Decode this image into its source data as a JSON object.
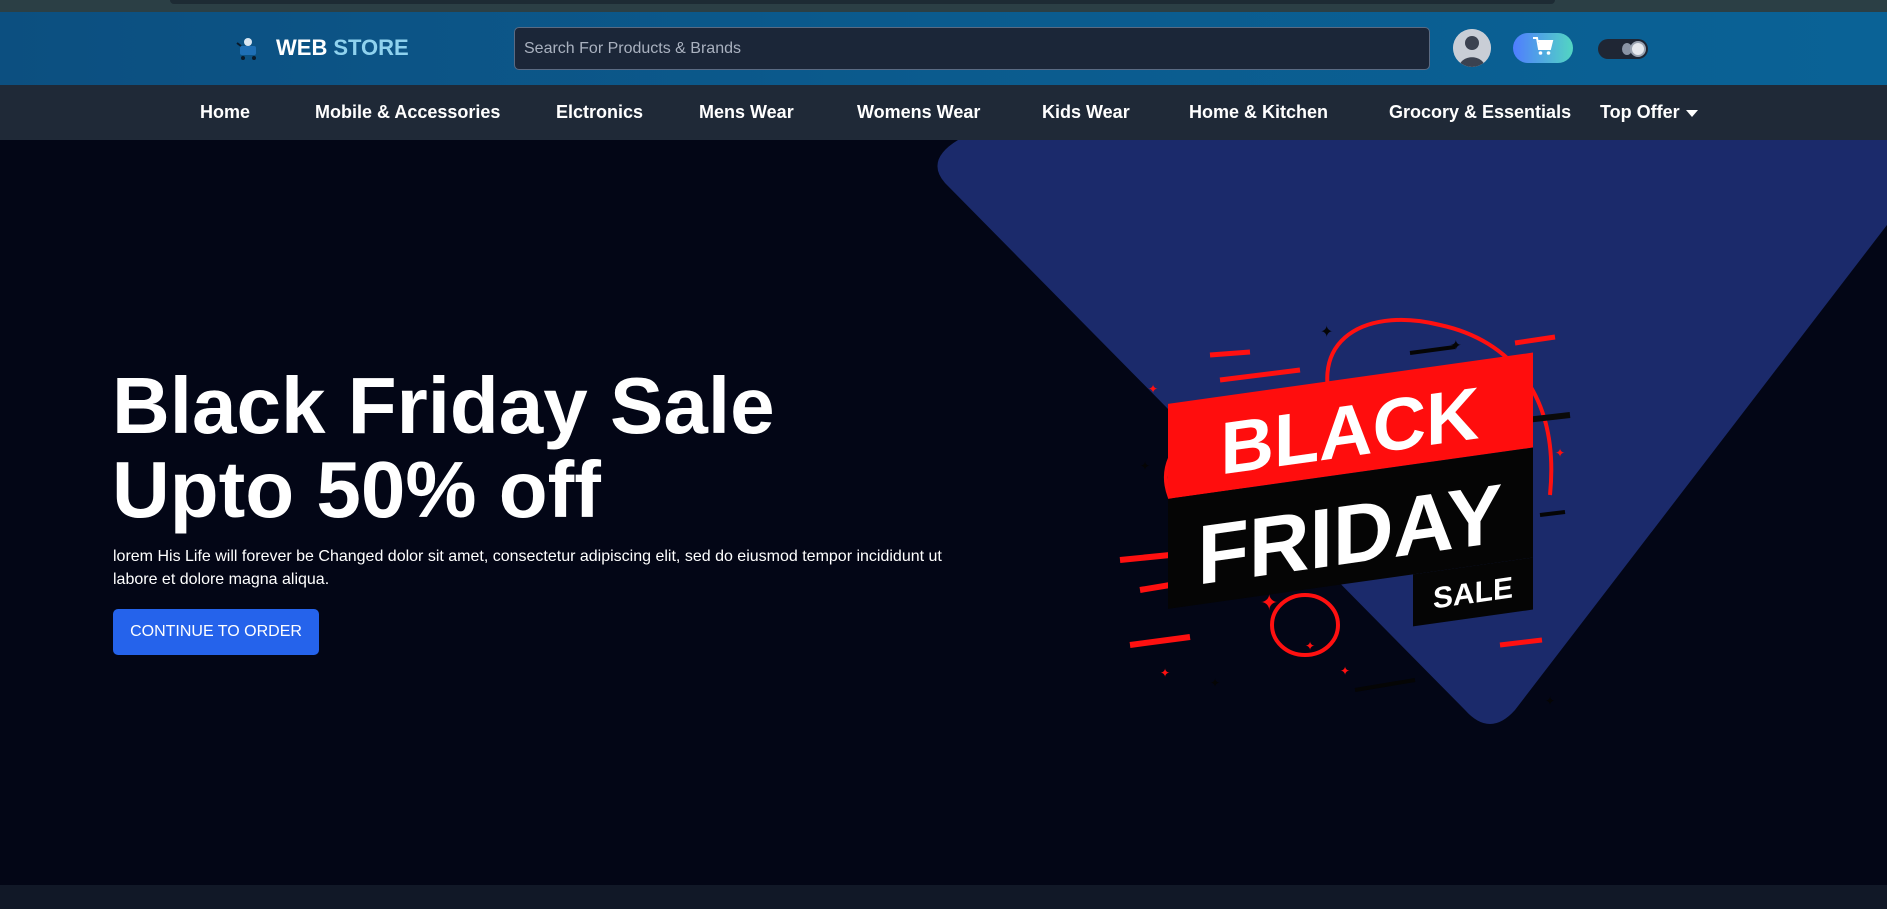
{
  "header": {
    "logo_web": "WEB",
    "logo_store": "STORE",
    "search_placeholder": "Search For Products & Brands"
  },
  "icons": {
    "logo": "shopping-logo-icon",
    "account": "user-avatar-icon",
    "cart": "cart-icon",
    "theme": "theme-toggle-icon"
  },
  "nav": {
    "items": [
      {
        "label": "Home"
      },
      {
        "label": "Mobile & Accessories"
      },
      {
        "label": "Elctronics"
      },
      {
        "label": "Mens Wear"
      },
      {
        "label": "Womens Wear"
      },
      {
        "label": "Kids Wear"
      },
      {
        "label": "Home & Kitchen"
      },
      {
        "label": "Grocory & Essentials"
      },
      {
        "label": "Top Offer"
      }
    ]
  },
  "hero": {
    "headline_line1": "Black Friday Sale",
    "headline_line2": "Upto 50% off",
    "description": "lorem His Life will forever be Changed dolor sit amet, consectetur adipiscing elit, sed do eiusmod tempor incididunt ut labore et dolore magna aliqua.",
    "cta_label": "CONTINUE TO ORDER",
    "badge_line1": "BLACK",
    "badge_line2": "FRIDAY",
    "badge_line3": "SALE"
  },
  "colors": {
    "header": "#0b5b8e",
    "nav": "#1f2937",
    "hero_bg": "#030616",
    "triangle": "#1b2a6b",
    "cta": "#2563eb",
    "badge_red": "#ff0d0d"
  }
}
